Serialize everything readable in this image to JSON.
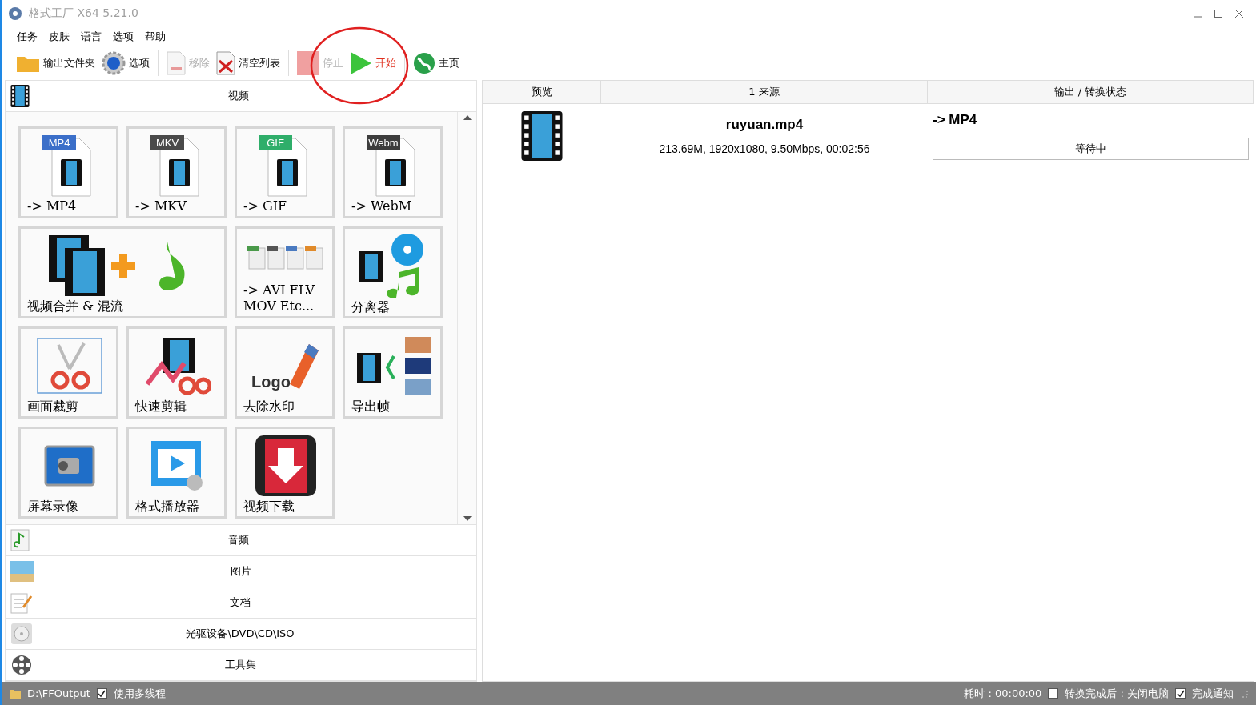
{
  "window": {
    "title": "格式工厂 X64 5.21.0"
  },
  "menu": [
    "任务",
    "皮肤",
    "语言",
    "选项",
    "帮助"
  ],
  "toolbar": [
    [
      {
        "kind": "folder",
        "label": "输出文件夹",
        "disabled": false
      },
      {
        "kind": "gear",
        "label": "选项",
        "disabled": false
      }
    ],
    [
      {
        "kind": "remove",
        "label": "移除",
        "disabled": true
      },
      {
        "kind": "clear",
        "label": "清空列表",
        "disabled": false
      }
    ],
    [
      {
        "kind": "stop",
        "label": "停止",
        "disabled": true
      },
      {
        "kind": "start",
        "label": "开始",
        "disabled": false,
        "highlighted": true
      }
    ],
    [
      {
        "kind": "globe",
        "label": "主页",
        "disabled": false
      }
    ]
  ],
  "categories": [
    {
      "kind": "video",
      "label": "视频",
      "tiles": [
        {
          "kind": "doc",
          "badge": "MP4",
          "color": "#3b6fc9",
          "label": "-> MP4",
          "wide": false
        },
        {
          "kind": "doc",
          "badge": "MKV",
          "color": "#4a4a4a",
          "label": "-> MKV",
          "wide": false
        },
        {
          "kind": "doc",
          "badge": "GIF",
          "color": "#2fae6a",
          "label": "-> GIF",
          "wide": false
        },
        {
          "kind": "doc",
          "badge": "Webm",
          "color": "#3d3d3d",
          "label": "-> WebM",
          "wide": false
        },
        {
          "kind": "merge",
          "label": "视频合并 & 混流",
          "wide": true
        },
        {
          "kind": "formats",
          "label": "-> AVI FLV MOV Etc...",
          "wide": false
        },
        {
          "kind": "splitter",
          "label": "分离器",
          "wide": false
        },
        {
          "kind": "crop",
          "label": "画面裁剪",
          "wide": false
        },
        {
          "kind": "quickcut",
          "label": "快速剪辑",
          "wide": false
        },
        {
          "kind": "watermark",
          "icon_text": "Logo",
          "label": "去除水印",
          "wide": false
        },
        {
          "kind": "frames",
          "label": "导出帧",
          "wide": false
        },
        {
          "kind": "recorder",
          "label": "屏幕录像",
          "wide": false
        },
        {
          "kind": "player",
          "label": "格式播放器",
          "wide": false
        },
        {
          "kind": "download",
          "label": "视频下载",
          "wide": false
        }
      ]
    },
    {
      "kind": "audio",
      "label": "音频"
    },
    {
      "kind": "image",
      "label": "图片"
    },
    {
      "kind": "document",
      "label": "文档"
    },
    {
      "kind": "disc",
      "label": "光驱设备\\DVD\\CD\\ISO"
    },
    {
      "kind": "tools",
      "label": "工具集"
    }
  ],
  "table": {
    "columns": [
      "预览",
      "1 来源",
      "输出 / 转换状态"
    ],
    "rows": [
      {
        "file": "ruyuan.mp4",
        "info": "213.69M, 1920x1080, 9.50Mbps, 00:02:56",
        "output": "-> MP4",
        "status": "等待中"
      }
    ]
  },
  "status_bar": {
    "path": "D:\\FFOutput",
    "multithread": {
      "label": "使用多线程",
      "checked": true
    },
    "elapsed": "耗时 : 00:00:00",
    "options": [
      {
        "label": "转换完成后 : 关闭电脑",
        "checked": false
      },
      {
        "label": "完成通知",
        "checked": true
      }
    ]
  }
}
